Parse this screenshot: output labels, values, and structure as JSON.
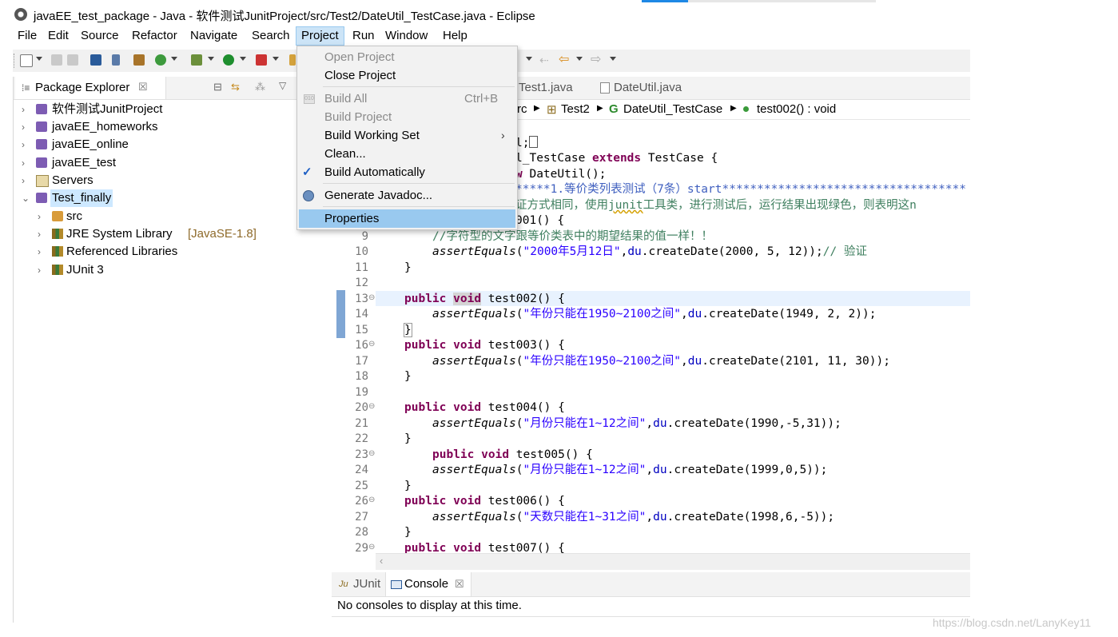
{
  "window": {
    "title": "javaEE_test_package - Java - 软件测试JunitProject/src/Test2/DateUtil_TestCase.java - Eclipse"
  },
  "menubar": {
    "items": [
      "File",
      "Edit",
      "Source",
      "Refactor",
      "Navigate",
      "Search",
      "Project",
      "Run",
      "Window",
      "Help"
    ],
    "active": "Project"
  },
  "project_menu": {
    "open_project": "Open Project",
    "close_project": "Close Project",
    "build_all": "Build All",
    "build_all_shortcut": "Ctrl+B",
    "build_project": "Build Project",
    "build_working_set": "Build Working Set",
    "clean": "Clean...",
    "build_automatically": "Build Automatically",
    "build_automatically_checked": true,
    "generate_javadoc": "Generate Javadoc...",
    "properties": "Properties"
  },
  "package_explorer": {
    "title": "Package Explorer",
    "close_glyph": "☒",
    "projects": [
      {
        "label": "软件测试JunitProject",
        "icon": "java-project-icon"
      },
      {
        "label": "javaEE_homeworks",
        "icon": "java-project-icon"
      },
      {
        "label": "javaEE_online",
        "icon": "java-project-icon"
      },
      {
        "label": "javaEE_test",
        "icon": "java-project-icon"
      },
      {
        "label": "Servers",
        "icon": "folder-icon"
      },
      {
        "label": "Test_finally",
        "icon": "java-project-icon",
        "expanded": true,
        "selected": true
      }
    ],
    "children": [
      {
        "label": "src",
        "icon": "package-folder-icon"
      },
      {
        "label": "JRE System Library",
        "suffix": "[JavaSE-1.8]",
        "icon": "library-icon"
      },
      {
        "label": "Referenced Libraries",
        "icon": "library-icon"
      },
      {
        "label": "JUnit 3",
        "icon": "library-icon"
      }
    ]
  },
  "editor": {
    "tabs": [
      "Test1.java",
      "DateUtil.java"
    ],
    "breadcrumb": {
      "src_part": "rc",
      "package": "Test2",
      "class": "DateUtil_TestCase",
      "method": "test002() : void"
    },
    "colors": {
      "keyword": "#7f0055",
      "string": "#2a00ff",
      "comment": "#3f7f5f",
      "javadoc": "#3f5fbf",
      "field": "#0000c0",
      "highlight_line": "#e8f2fe"
    }
  },
  "code": {
    "l5a": "l;",
    "l6a": "l_TestCase ",
    "l6b": "extends",
    "l6c": " TestCase {",
    "l7a": "w",
    "l7b": " DateUtil();",
    "l8": "*****1.等价类列表测试（7条）start***********************************",
    "l9a": "证方式相同，使用",
    "l9b": "junit",
    "l9c": "工具类，进行测试后，运行结果出现绿色，则表明这n",
    "l10": "001() {",
    "ln9": "9",
    "ln10": "10",
    "ln11": "11",
    "ln12": "12",
    "ln13": "13",
    "ln14": "14",
    "ln15": "15",
    "ln16": "16",
    "ln17": "17",
    "ln18": "18",
    "ln19": "19",
    "ln20": "20",
    "ln21": "21",
    "ln22": "22",
    "ln23": "23",
    "ln24": "24",
    "ln25": "25",
    "ln26": "26",
    "ln27": "27",
    "ln28": "28",
    "ln29": "29",
    "c9": "//字符型的文字跟等价类表中的期望结果的值一样！！",
    "assert": "assertEquals",
    "public": "public",
    "void": "void",
    "du": "du",
    "s10": "\"2000年5月12日\"",
    "a10": ".createDate(2000, 5, 12));",
    "c10": "// 验证",
    "close": "}",
    "m13": " test002() {",
    "s14": "\"年份只能在1950~2100之间\"",
    "a14": ".createDate(1949, 2, 2));",
    "m16": " test003() {",
    "s17": "\"年份只能在1950~2100之间\"",
    "a17": ".createDate(2101, 11, 30));",
    "m20": " test004() {",
    "s21": "\"月份只能在1~12之间\"",
    "a21": ".createDate(1990,-5,31));",
    "m23": " test005() {",
    "s24": "\"月份只能在1~12之间\"",
    "a24": ".createDate(1999,0,5));",
    "m26": " test006() {",
    "s27": "\"天数只能在1~31之间\"",
    "a27": ".createDate(1998,6,-5));",
    "m29": " test007() {"
  },
  "bottom_panel": {
    "tabs": [
      "JUnit",
      "Console"
    ],
    "junit_prefix": "Ju",
    "active": "Console",
    "message": "No consoles to display at this time."
  },
  "watermark": "https://blog.csdn.net/LanyKey11"
}
